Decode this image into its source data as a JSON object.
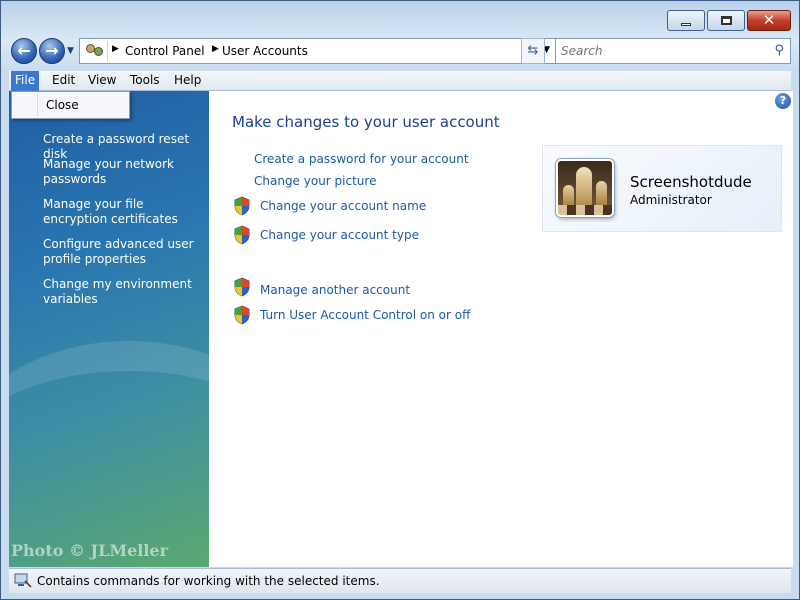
{
  "window": {
    "caption_buttons": {
      "minimize": "minimize",
      "maximize": "maximize",
      "close": "✕"
    }
  },
  "nav": {
    "back_icon": "arrow-left-icon",
    "forward_icon": "arrow-right-icon",
    "breadcrumbs": [
      "Control Panel",
      "User Accounts"
    ],
    "search_placeholder": "Search"
  },
  "menubar": {
    "items": [
      {
        "label": "File",
        "active": true
      },
      {
        "label": "Edit"
      },
      {
        "label": "View"
      },
      {
        "label": "Tools"
      },
      {
        "label": "Help"
      }
    ]
  },
  "file_menu": {
    "items": [
      "Close"
    ]
  },
  "sidebar": {
    "links": [
      "Create a password reset disk",
      "Manage your network passwords",
      "Manage your file encryption certificates",
      "Configure advanced user profile properties",
      "Change my environment variables"
    ],
    "watermark": "Photo © JLMeller"
  },
  "main": {
    "heading": "Make changes to your user account",
    "links": {
      "create_password": "Create a password for your account",
      "change_picture": "Change your picture",
      "change_name": "Change your account name",
      "change_type": "Change your account type",
      "manage_other": "Manage another account",
      "uac": "Turn User Account Control on or off"
    }
  },
  "user": {
    "name": "Screenshotdude",
    "role": "Administrator"
  },
  "statusbar": {
    "text": "Contains commands for working with the selected items."
  },
  "colors": {
    "link": "#1c5aa6",
    "heading": "#1c3f94",
    "menu_highlight": "#3b79d1"
  }
}
